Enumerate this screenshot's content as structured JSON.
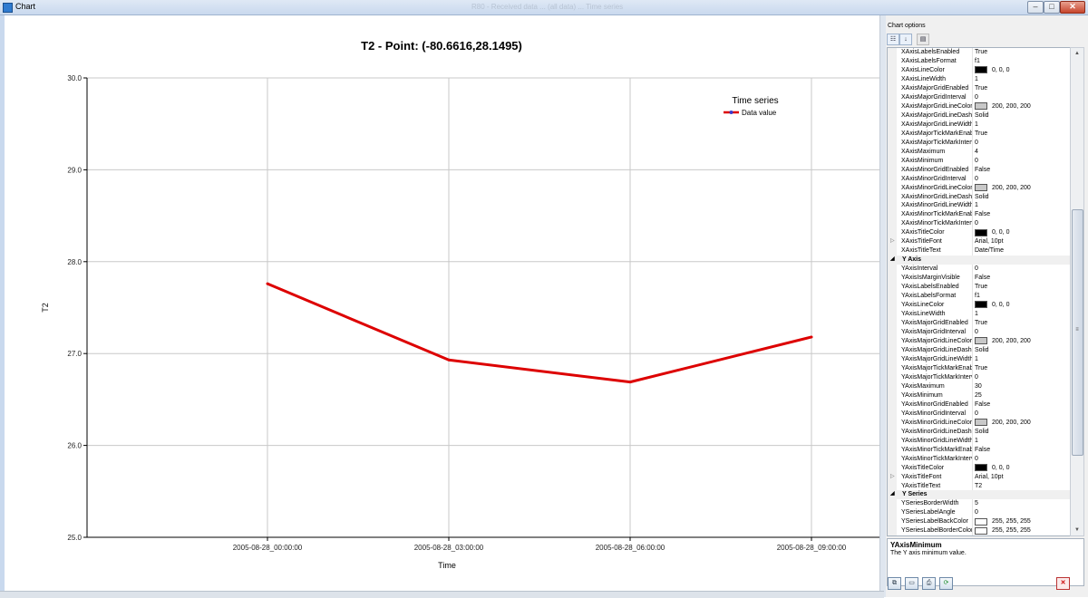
{
  "window": {
    "title": "Chart",
    "center_text": "R80 - Received data ... (all data) ... Time series",
    "buttons": {
      "minimize": "–",
      "maximize": "□",
      "close": "✕"
    }
  },
  "chart_data": {
    "type": "line",
    "title": "T2 - Point: (-80.6616,28.1495)",
    "xlabel": "Time",
    "ylabel": "T2",
    "x_ticks": [
      "2005-08-28_00:00:00",
      "2005-08-28_03:00:00",
      "2005-08-28_06:00:00",
      "2005-08-28_09:00:00"
    ],
    "y_ticks": [
      "25.0",
      "26.0",
      "27.0",
      "28.0",
      "29.0",
      "30.0"
    ],
    "ylim": [
      25,
      30
    ],
    "xlim": [
      0,
      4
    ],
    "grid": true,
    "legend": {
      "title": "Time series",
      "position": "top-right"
    },
    "series": [
      {
        "name": "Data value",
        "color": "#dd0000",
        "x": [
          "2005-08-28_00:00:00",
          "2005-08-28_03:00:00",
          "2005-08-28_06:00:00",
          "2005-08-28_09:00:00"
        ],
        "y": [
          27.76,
          26.93,
          26.69,
          27.18
        ]
      }
    ]
  },
  "panel": {
    "title": "Chart options",
    "toolbar": {
      "categorized_icon": "categorized-icon",
      "alphabetical_icon": "sort-az-icon",
      "property_pages_icon": "property-pages-icon"
    },
    "rows": [
      {
        "kind": "prop",
        "name": "XAxisLabelsEnabled",
        "value": "True"
      },
      {
        "kind": "prop",
        "name": "XAxisLabelsFormat",
        "value": "f1"
      },
      {
        "kind": "prop",
        "name": "XAxisLineColor",
        "value": "0, 0, 0",
        "swatch": "#000000"
      },
      {
        "kind": "prop",
        "name": "XAxisLineWidth",
        "value": "1"
      },
      {
        "kind": "prop",
        "name": "XAxisMajorGridEnabled",
        "value": "True"
      },
      {
        "kind": "prop",
        "name": "XAxisMajorGridInterval",
        "value": "0"
      },
      {
        "kind": "prop",
        "name": "XAxisMajorGridLineColor",
        "value": "200, 200, 200",
        "swatch": "#c8c8c8"
      },
      {
        "kind": "prop",
        "name": "XAxisMajorGridLineDashSt",
        "value": "Solid"
      },
      {
        "kind": "prop",
        "name": "XAxisMajorGridLineWidth",
        "value": "1"
      },
      {
        "kind": "prop",
        "name": "XAxisMajorTickMarkEnable",
        "value": "True"
      },
      {
        "kind": "prop",
        "name": "XAxisMajorTickMarkInterva",
        "value": "0"
      },
      {
        "kind": "prop",
        "name": "XAxisMaximum",
        "value": "4"
      },
      {
        "kind": "prop",
        "name": "XAxisMinimum",
        "value": "0"
      },
      {
        "kind": "prop",
        "name": "XAxisMinorGridEnabled",
        "value": "False"
      },
      {
        "kind": "prop",
        "name": "XAxisMinorGridInterval",
        "value": "0"
      },
      {
        "kind": "prop",
        "name": "XAxisMinorGridLineColor",
        "value": "200, 200, 200",
        "swatch": "#c8c8c8"
      },
      {
        "kind": "prop",
        "name": "XAxisMinorGridLineDashSt",
        "value": "Solid"
      },
      {
        "kind": "prop",
        "name": "XAxisMinorGridLineWidth",
        "value": "1"
      },
      {
        "kind": "prop",
        "name": "XAxisMinorTickMarkEnable",
        "value": "False"
      },
      {
        "kind": "prop",
        "name": "XAxisMinorTickMarkInterva",
        "value": "0"
      },
      {
        "kind": "prop",
        "name": "XAxisTitleColor",
        "value": "0, 0, 0",
        "swatch": "#000000"
      },
      {
        "kind": "prop",
        "name": "XAxisTitleFont",
        "value": "Arial, 10pt",
        "expander": "▷"
      },
      {
        "kind": "prop",
        "name": "XAxisTitleText",
        "value": "Date/Time"
      },
      {
        "kind": "cat",
        "name": "Y Axis",
        "expander": "◢"
      },
      {
        "kind": "prop",
        "name": "YAxisInterval",
        "value": "0"
      },
      {
        "kind": "prop",
        "name": "YAxisIsMarginVisible",
        "value": "False"
      },
      {
        "kind": "prop",
        "name": "YAxisLabelsEnabled",
        "value": "True"
      },
      {
        "kind": "prop",
        "name": "YAxisLabelsFormat",
        "value": "f1"
      },
      {
        "kind": "prop",
        "name": "YAxisLineColor",
        "value": "0, 0, 0",
        "swatch": "#000000"
      },
      {
        "kind": "prop",
        "name": "YAxisLineWidth",
        "value": "1"
      },
      {
        "kind": "prop",
        "name": "YAxisMajorGridEnabled",
        "value": "True"
      },
      {
        "kind": "prop",
        "name": "YAxisMajorGridInterval",
        "value": "0"
      },
      {
        "kind": "prop",
        "name": "YAxisMajorGridLineColor",
        "value": "200, 200, 200",
        "swatch": "#c8c8c8"
      },
      {
        "kind": "prop",
        "name": "YAxisMajorGridLineDashSt",
        "value": "Solid"
      },
      {
        "kind": "prop",
        "name": "YAxisMajorGridLineWidth",
        "value": "1"
      },
      {
        "kind": "prop",
        "name": "YAxisMajorTickMarkEnable",
        "value": "True"
      },
      {
        "kind": "prop",
        "name": "YAxisMajorTickMarkInterva",
        "value": "0"
      },
      {
        "kind": "prop",
        "name": "YAxisMaximum",
        "value": "30"
      },
      {
        "kind": "prop",
        "name": "YAxisMinimum",
        "value": "25"
      },
      {
        "kind": "prop",
        "name": "YAxisMinorGridEnabled",
        "value": "False"
      },
      {
        "kind": "prop",
        "name": "YAxisMinorGridInterval",
        "value": "0"
      },
      {
        "kind": "prop",
        "name": "YAxisMinorGridLineColor",
        "value": "200, 200, 200",
        "swatch": "#c8c8c8"
      },
      {
        "kind": "prop",
        "name": "YAxisMinorGridLineDashSt",
        "value": "Solid"
      },
      {
        "kind": "prop",
        "name": "YAxisMinorGridLineWidth",
        "value": "1"
      },
      {
        "kind": "prop",
        "name": "YAxisMinorTickMarkEnable",
        "value": "False"
      },
      {
        "kind": "prop",
        "name": "YAxisMinorTickMarkInterva",
        "value": "0"
      },
      {
        "kind": "prop",
        "name": "YAxisTitleColor",
        "value": "0, 0, 0",
        "swatch": "#000000"
      },
      {
        "kind": "prop",
        "name": "YAxisTitleFont",
        "value": "Arial, 10pt",
        "expander": "▷"
      },
      {
        "kind": "prop",
        "name": "YAxisTitleText",
        "value": "T2"
      },
      {
        "kind": "cat",
        "name": "Y Series",
        "expander": "◢"
      },
      {
        "kind": "prop",
        "name": "YSeriesBorderWidth",
        "value": "5"
      },
      {
        "kind": "prop",
        "name": "YSeriesLabelAngle",
        "value": "0"
      },
      {
        "kind": "prop",
        "name": "YSeriesLabelBackColor",
        "value": "255, 255, 255",
        "swatch": "#ffffff"
      },
      {
        "kind": "prop",
        "name": "YSeriesLabelBorderColor",
        "value": "255, 255, 255",
        "swatch": "#ffffff"
      }
    ],
    "description": {
      "title": "YAxisMinimum",
      "text": "The Y axis minimum value."
    },
    "scroll_grip": "≡",
    "bottom_tools": {
      "copy": "⧉",
      "save": "▭",
      "print": "⎙",
      "refresh": "⟳",
      "close": "✕"
    }
  }
}
